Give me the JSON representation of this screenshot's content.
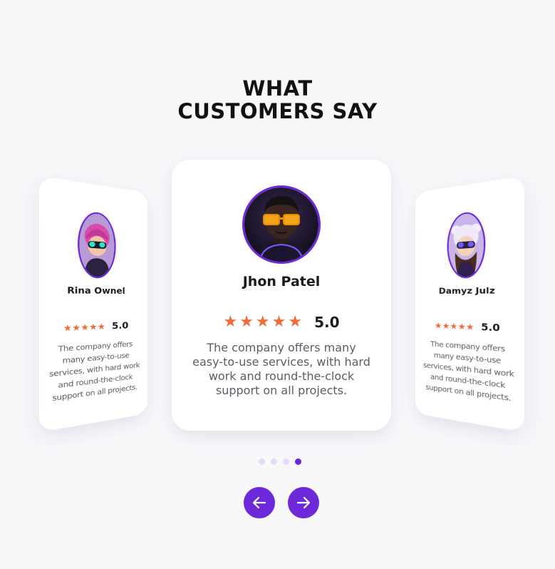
{
  "heading": {
    "line1": "WHAT",
    "line2": "CUSTOMERS SAY"
  },
  "testimonials": [
    {
      "name": "Rina Ownel",
      "stars": "★★★★★",
      "rating": "5.0",
      "quote": "The company offers many easy-to-use services, with hard work and round-the-clock support on all projects."
    },
    {
      "name": "Jhon Patel",
      "stars": "★★★★★",
      "rating": "5.0",
      "quote": "The company offers many easy-to-use services, with hard work and round-the-clock support on all projects."
    },
    {
      "name": "Damyz Julz",
      "stars": "★★★★★",
      "rating": "5.0",
      "quote": "The company offers many easy-to-use services, with hard work and round-the-clock support on all projects."
    }
  ],
  "pagination": {
    "count": 4,
    "active_index": 3
  },
  "nav": {
    "prev_icon": "arrow-left-icon",
    "next_icon": "arrow-right-icon"
  },
  "colors": {
    "accent": "#6d28d9",
    "star": "#ef6b3a",
    "background": "#f8f8fb",
    "dot_inactive": "#e5dcf7"
  }
}
